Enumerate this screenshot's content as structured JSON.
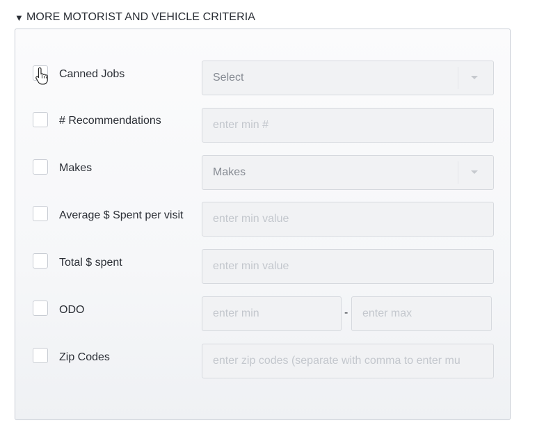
{
  "section": {
    "toggle_glyph": "▼",
    "title": "MORE MOTORIST AND VEHICLE CRITERIA"
  },
  "criteria": {
    "canned_jobs": {
      "label": "Canned Jobs",
      "selected": "Select",
      "checked": false
    },
    "recommendations": {
      "label": "# Recommendations",
      "placeholder": "enter min #",
      "checked": false
    },
    "makes": {
      "label": "Makes",
      "selected": "Makes",
      "checked": false
    },
    "avg_spent": {
      "label": "Average $ Spent per visit",
      "placeholder": "enter min value",
      "checked": false
    },
    "total_spent": {
      "label": "Total $ spent",
      "placeholder": "enter min value",
      "checked": false
    },
    "odo": {
      "label": "ODO",
      "min_placeholder": "enter min",
      "separator": "-",
      "max_placeholder": "enter max",
      "checked": false
    },
    "zip_codes": {
      "label": "Zip Codes",
      "placeholder": "enter zip codes (separate with comma to enter mu",
      "checked": false
    }
  },
  "icons": {
    "dropdown": "chevron-down-icon",
    "cursor": "hand-pointer-icon"
  },
  "colors": {
    "panel_border": "#c9ced6",
    "field_bg": "#f1f2f4",
    "placeholder": "#c3c7cd",
    "text": "#2b2f36"
  }
}
